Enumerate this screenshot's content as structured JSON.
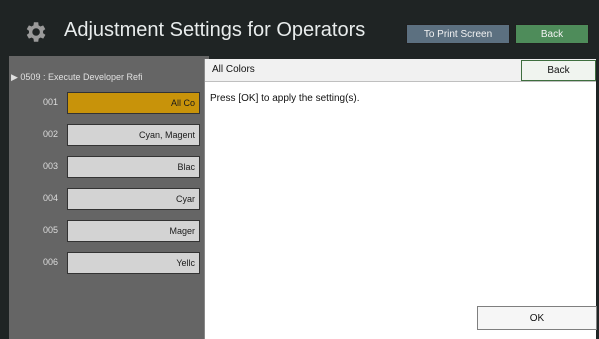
{
  "header": {
    "title": "Adjustment Settings for Operators",
    "print_button_label": "To Print Screen",
    "back_button_label": "Back"
  },
  "setting": {
    "code_line": "▶ 0509  : Execute Developer Refi"
  },
  "list": {
    "items": [
      {
        "number": "001",
        "label": "All Co"
      },
      {
        "number": "002",
        "label": "Cyan, Magent"
      },
      {
        "number": "003",
        "label": "Blac"
      },
      {
        "number": "004",
        "label": "Cyar"
      },
      {
        "number": "005",
        "label": "Mager"
      },
      {
        "number": "006",
        "label": "Yellc"
      }
    ],
    "selected_index": 0
  },
  "dialog": {
    "title": "All Colors",
    "back_label": "Back",
    "message": "Press [OK] to apply the setting(s).",
    "ok_label": "OK"
  },
  "colors": {
    "header_bg": "#1f2424",
    "selected_item": "#c8930a",
    "back_button": "#4e8c5a",
    "print_button": "#5c7080"
  }
}
